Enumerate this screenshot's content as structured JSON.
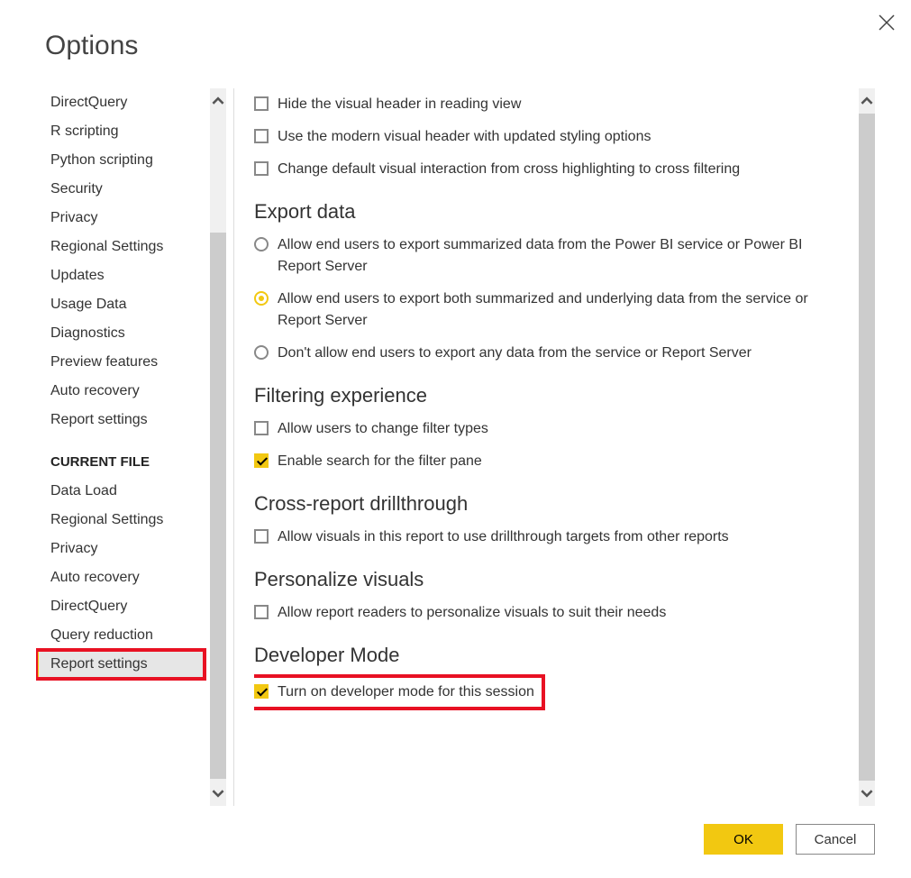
{
  "dialog": {
    "title": "Options",
    "ok": "OK",
    "cancel": "Cancel"
  },
  "sidebar": {
    "global_items": [
      "DirectQuery",
      "R scripting",
      "Python scripting",
      "Security",
      "Privacy",
      "Regional Settings",
      "Updates",
      "Usage Data",
      "Diagnostics",
      "Preview features",
      "Auto recovery",
      "Report settings"
    ],
    "current_file_header": "CURRENT FILE",
    "current_file_items": [
      "Data Load",
      "Regional Settings",
      "Privacy",
      "Auto recovery",
      "DirectQuery",
      "Query reduction",
      "Report settings"
    ],
    "selected": "Report settings"
  },
  "content": {
    "visual_options": [
      "Hide the visual header in reading view",
      "Use the modern visual header with updated styling options",
      "Change default visual interaction from cross highlighting to cross filtering"
    ],
    "export": {
      "heading": "Export data",
      "options": [
        "Allow end users to export summarized data from the Power BI service or Power BI Report Server",
        "Allow end users to export both summarized and underlying data from the service or Report Server",
        "Don't allow end users to export any data from the service or Report Server"
      ],
      "selected_index": 1
    },
    "filtering": {
      "heading": "Filtering experience",
      "opt0": {
        "label": "Allow users to change filter types",
        "checked": false
      },
      "opt1": {
        "label": "Enable search for the filter pane",
        "checked": true
      }
    },
    "crossreport": {
      "heading": "Cross-report drillthrough",
      "opt0": {
        "label": "Allow visuals in this report to use drillthrough targets from other reports",
        "checked": false
      }
    },
    "personalize": {
      "heading": "Personalize visuals",
      "opt0": {
        "label": "Allow report readers to personalize visuals to suit their needs",
        "checked": false
      }
    },
    "developer": {
      "heading": "Developer Mode",
      "opt0": {
        "label": "Turn on developer mode for this session",
        "checked": true
      }
    }
  }
}
